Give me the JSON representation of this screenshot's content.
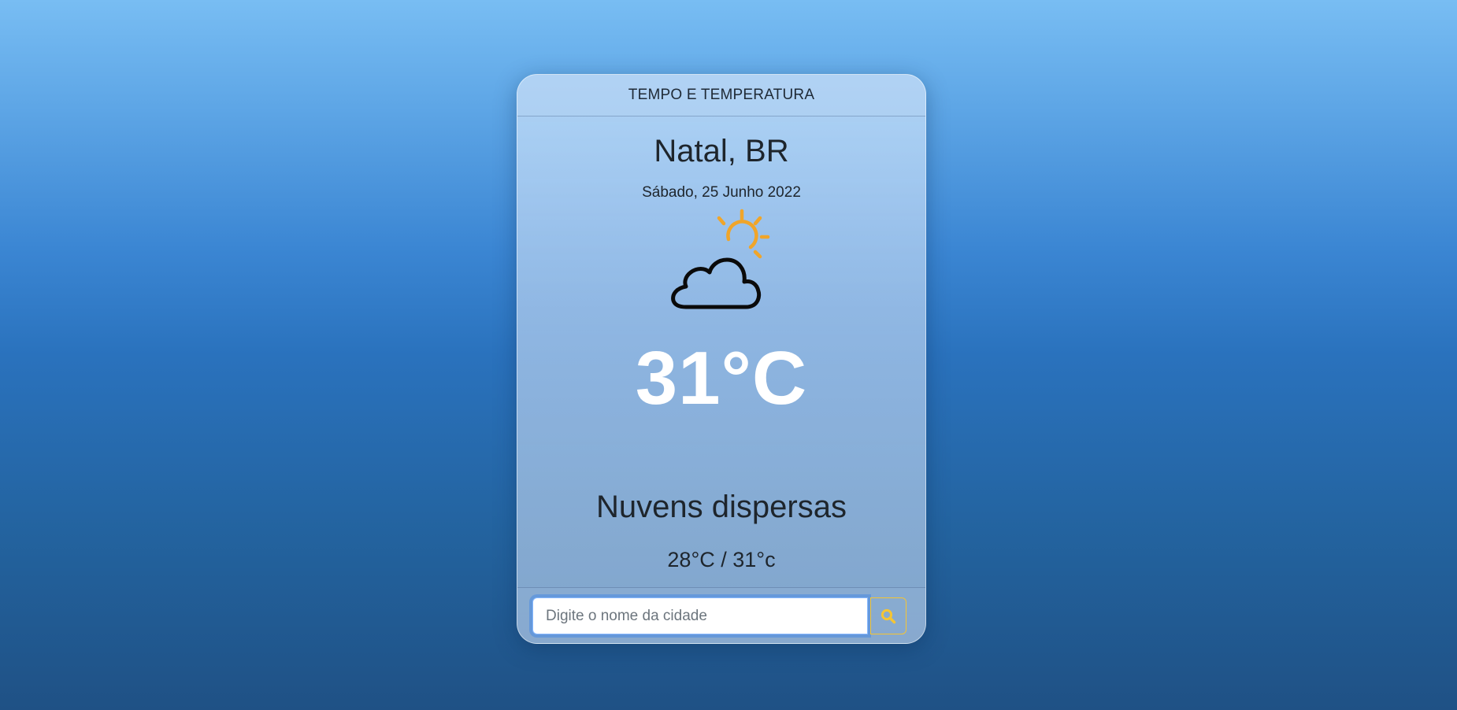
{
  "header": {
    "title": "TEMPO E TEMPERATURA"
  },
  "weather": {
    "city": "Natal, BR",
    "date": "Sábado, 25 Junho 2022",
    "icon": "partly-cloudy-icon",
    "temperature": "31°C",
    "description": "Nuvens dispersas",
    "min_max": "28°C / 31°c"
  },
  "search": {
    "placeholder": "Digite o nome da cidade",
    "value": "",
    "button_icon": "search-icon"
  },
  "colors": {
    "sun": "#f0a52a",
    "search_accent": "#f5c533",
    "temperature_text": "#ffffff"
  }
}
